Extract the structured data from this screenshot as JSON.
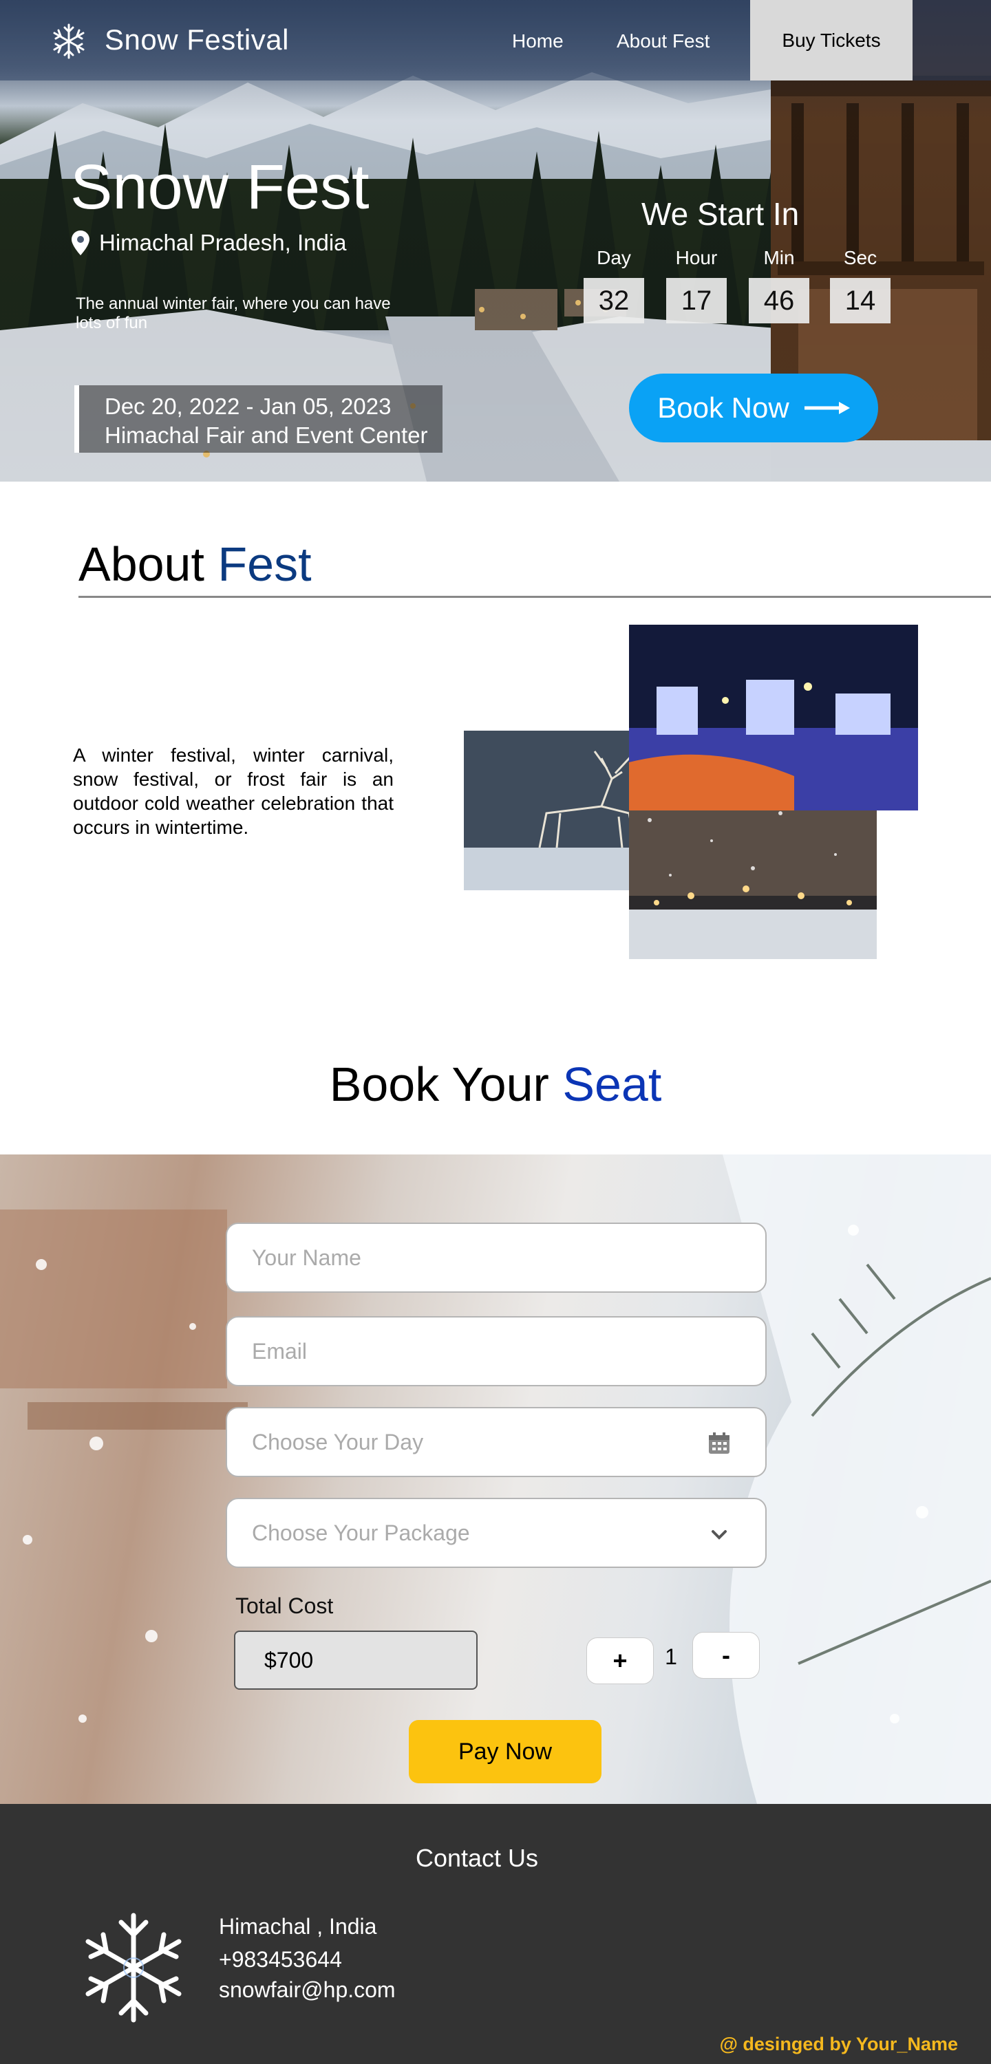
{
  "nav": {
    "brand": "Snow Festival",
    "links": [
      "Home",
      "About Fest"
    ],
    "cta": "Buy Tickets"
  },
  "hero": {
    "title": "Snow Fest",
    "location": "Himachal Pradesh, India",
    "tagline": "The annual winter fair, where you can have lots of fun",
    "dates": "Dec 20, 2022 - Jan 05, 2023",
    "venue": "Himachal Fair and Event Center",
    "countdown_title": "We Start In",
    "countdown": [
      {
        "label": "Day",
        "value": "32"
      },
      {
        "label": "Hour",
        "value": "17"
      },
      {
        "label": "Min",
        "value": "46"
      },
      {
        "label": "Sec",
        "value": "14"
      }
    ],
    "book_now": "Book Now"
  },
  "about": {
    "heading_main": "About ",
    "heading_accent": "Fest",
    "text": "A winter festival, winter carnival, snow festival, or frost fair is an outdoor cold weather celebration that occurs in wintertime."
  },
  "booking": {
    "heading_main": "Book Your ",
    "heading_accent": "Seat",
    "name_placeholder": "Your Name",
    "email_placeholder": "Email",
    "day_placeholder": "Choose Your Day",
    "package_placeholder": "Choose Your Package",
    "total_label": "Total Cost",
    "total_value": "$700",
    "plus": "+",
    "quantity": "1",
    "minus": "-",
    "pay": "Pay Now"
  },
  "footer": {
    "title": "Contact Us",
    "address": "Himachal , India",
    "phone": "+983453644",
    "email": "snowfair@hp.com",
    "credit": "@ desinged by Your_Name"
  },
  "colors": {
    "accent_blue": "#0b3a80",
    "book_now_blue": "#0aa2f5",
    "pay_yellow": "#fcc30f",
    "footer_bg": "#333333",
    "credit_yellow": "#f5b81e"
  },
  "icons": [
    "snowflake-icon",
    "location-pin-icon",
    "arrow-right-icon",
    "calendar-icon",
    "chevron-down-icon"
  ]
}
